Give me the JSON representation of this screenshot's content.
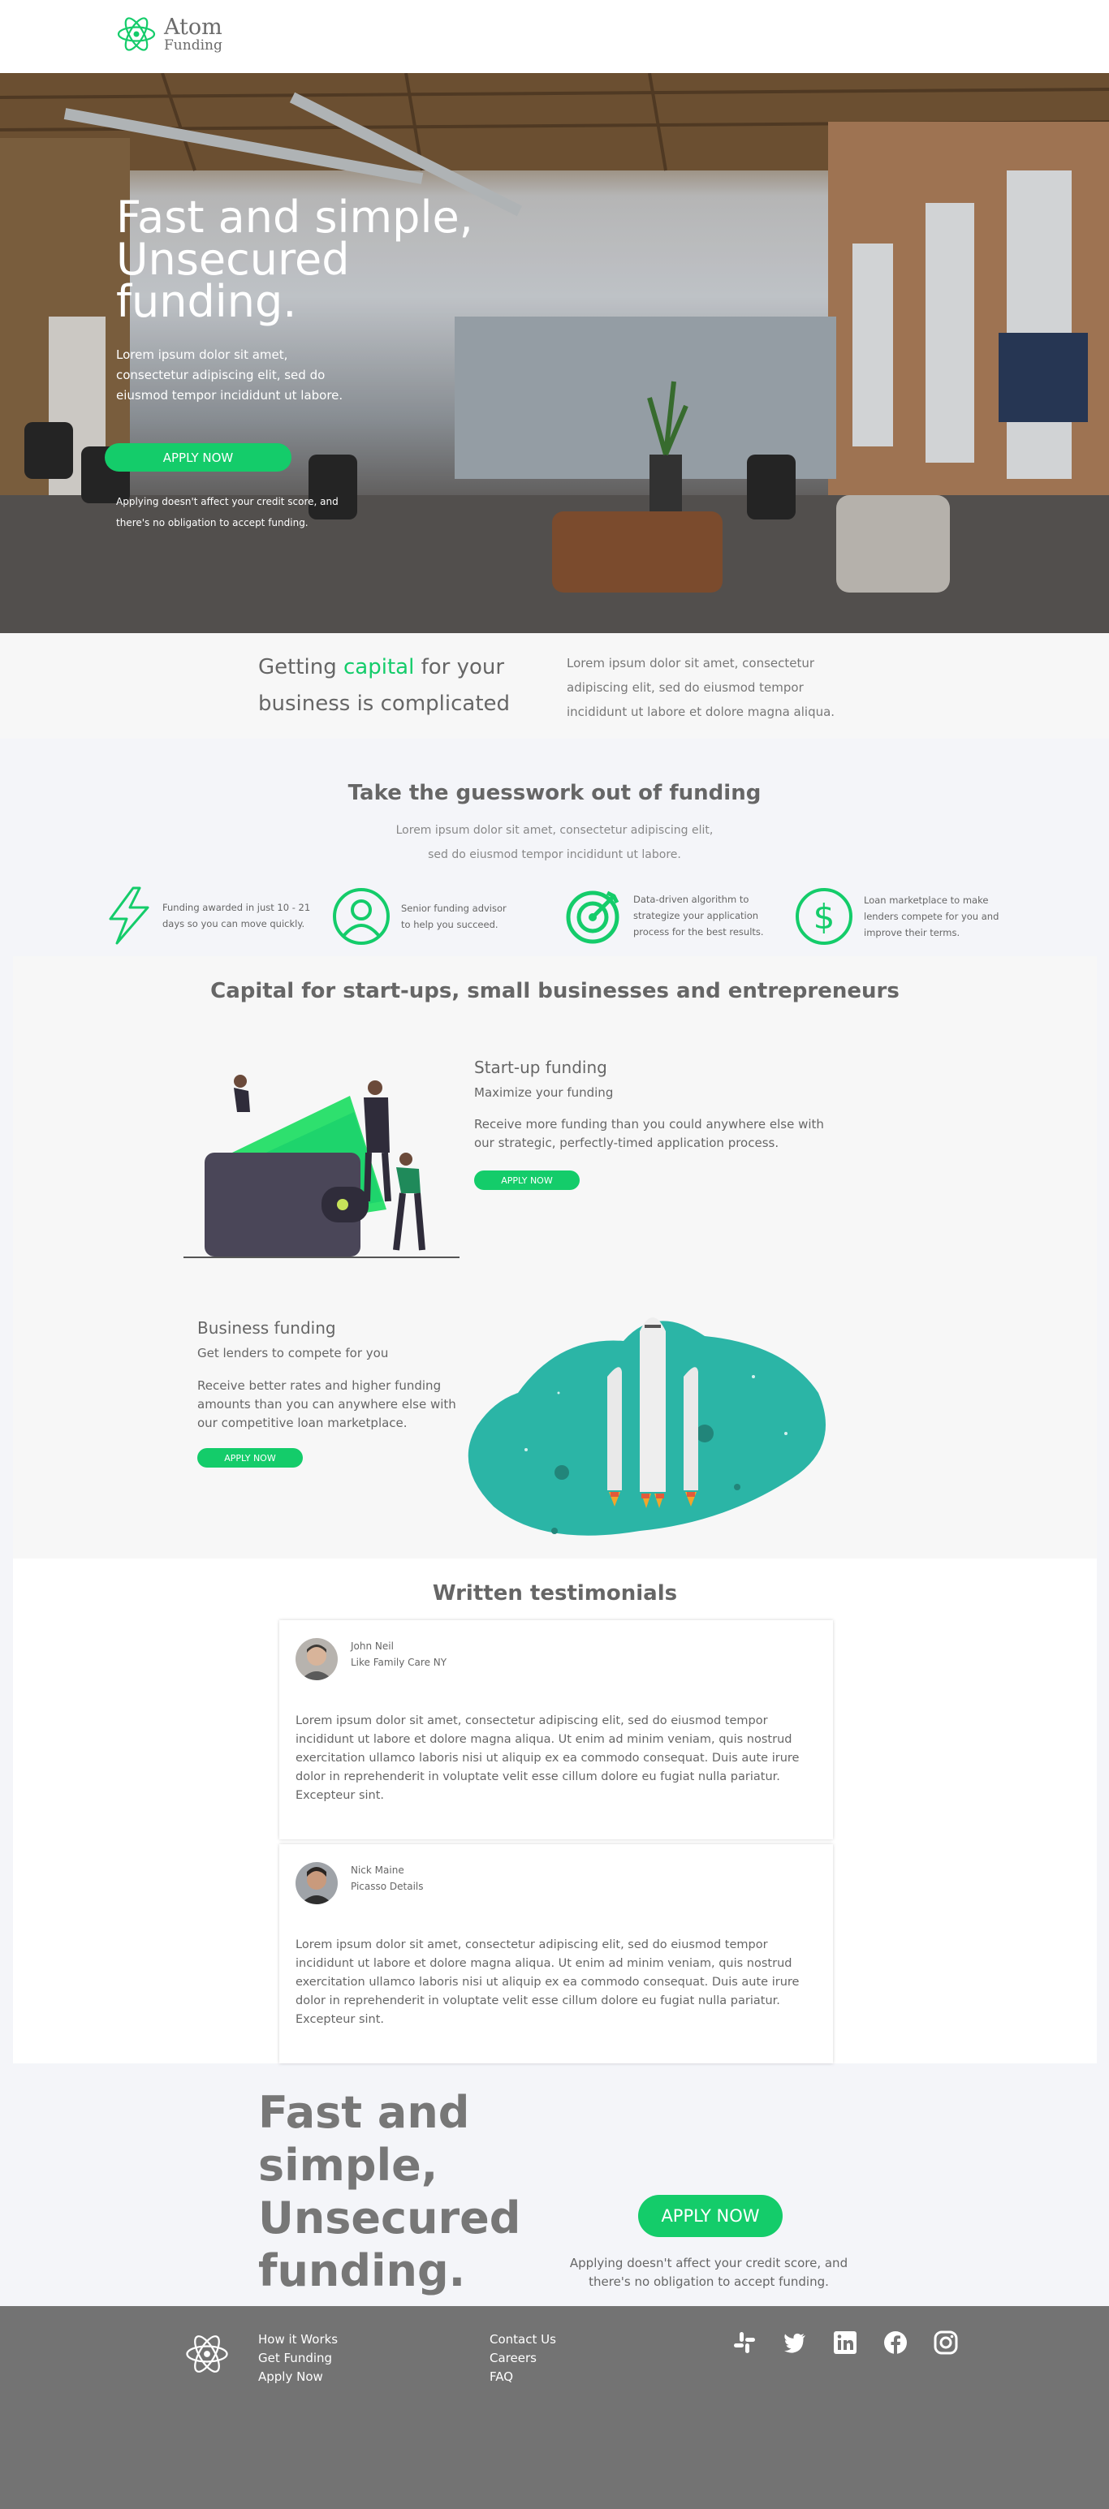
{
  "nav": {
    "logo_name": "Atom",
    "logo_sub": "Funding"
  },
  "hero": {
    "title": "Fast and simple, Unsecured funding.",
    "subtitle": "Lorem ipsum dolor sit amet, consectetur adipiscing elit, sed do eiusmod tempor incididunt ut labore.",
    "button": "APPLY NOW",
    "note": "Applying doesn't affect your credit score, and there's no obligation to accept funding."
  },
  "intro": {
    "title_before": "Getting ",
    "title_accent": "capital",
    "title_after": " for your business is complicated",
    "text": "Lorem ipsum dolor sit amet, consectetur adipiscing elit, sed do eiusmod tempor incididunt ut labore et dolore magna aliqua."
  },
  "features": {
    "title": "Take the guesswork out of funding",
    "subtitle": "Lorem ipsum dolor sit amet, consectetur adipiscing elit, sed do eiusmod tempor incididunt ut labore.",
    "items": [
      {
        "icon": "lightning-icon",
        "text": "Funding awarded in just 10 - 21 days so you can move quickly."
      },
      {
        "icon": "user-icon",
        "text": "Senior funding advisor to help you succeed."
      },
      {
        "icon": "target-icon",
        "text": "Data-driven algorithm to strategize your application process for the best results."
      },
      {
        "icon": "dollar-icon",
        "text": "Loan marketplace to make lenders compete for you and improve their terms."
      }
    ]
  },
  "capital": {
    "title": "Capital for start-ups, small businesses and entrepreneurs",
    "startup": {
      "title": "Start-up funding",
      "subtitle": "Maximize your funding",
      "text": "Receive more funding than you could anywhere else with our strategic, perfectly-timed application process.",
      "button": "APPLY NOW"
    },
    "business": {
      "title": "Business funding",
      "subtitle": "Get lenders to compete for you",
      "text": "Receive better rates and higher funding amounts than you can anywhere else with our competitive loan marketplace.",
      "button": "APPLY NOW"
    }
  },
  "testimonials": {
    "title": "Written testimonials",
    "items": [
      {
        "name": "John Neil",
        "company": "Like Family Care NY",
        "text": "Lorem ipsum dolor sit amet, consectetur adipiscing elit, sed do eiusmod tempor incididunt ut labore et dolore magna aliqua. Ut enim ad minim veniam, quis nostrud exercitation ullamco laboris nisi ut aliquip ex ea commodo consequat. Duis aute irure dolor in reprehenderit in voluptate velit esse cillum dolore eu fugiat nulla pariatur. Excepteur sint."
      },
      {
        "name": "Nick Maine",
        "company": "Picasso Details",
        "text": "Lorem ipsum dolor sit amet, consectetur adipiscing elit, sed do eiusmod tempor incididunt ut labore et dolore magna aliqua. Ut enim ad minim veniam, quis nostrud exercitation ullamco laboris nisi ut aliquip ex ea commodo consequat. Duis aute irure dolor in reprehenderit in voluptate velit esse cillum dolore eu fugiat nulla pariatur. Excepteur sint."
      }
    ]
  },
  "cta": {
    "title": "Fast and simple, Unsecured funding.",
    "button": "APPLY NOW",
    "note": "Applying doesn't affect your credit score, and there's no obligation to accept funding."
  },
  "footer": {
    "col1": [
      "How it Works",
      "Get Funding",
      "Apply Now"
    ],
    "col2": [
      "Contact Us",
      "Careers",
      "FAQ"
    ],
    "social": [
      "slack-icon",
      "twitter-icon",
      "linkedin-icon",
      "facebook-icon",
      "instagram-icon"
    ]
  },
  "colors": {
    "accent": "#14cc6a",
    "footer": "#737373",
    "teal": "#2bb5a6",
    "purple": "#4a4658"
  }
}
